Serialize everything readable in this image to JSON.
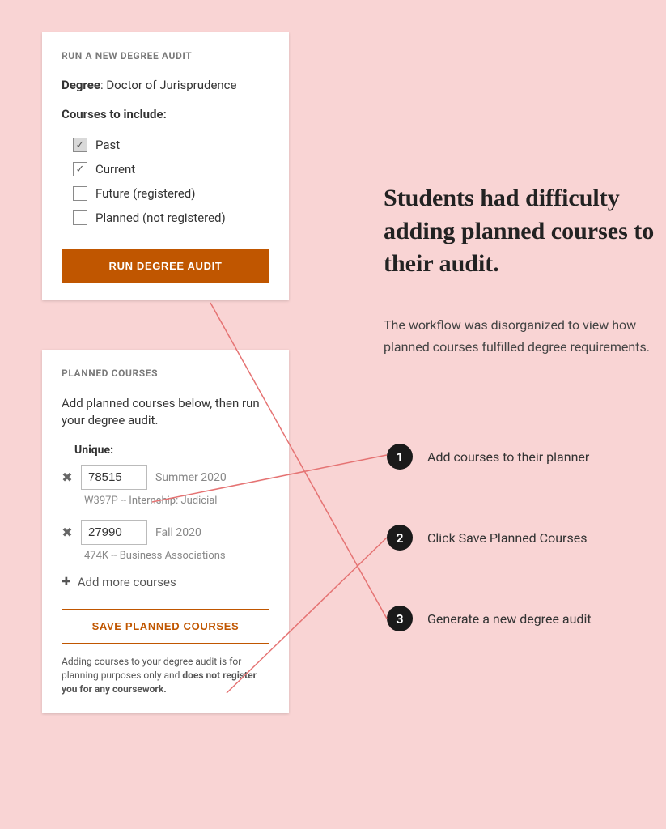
{
  "audit_panel": {
    "title": "RUN A NEW DEGREE AUDIT",
    "degree_label": "Degree",
    "degree_value": ": Doctor of Jurisprudence",
    "courses_label": "Courses to include",
    "courses_colon": ":",
    "options": [
      {
        "label": "Past",
        "checked": true,
        "disabled": true
      },
      {
        "label": "Current",
        "checked": true,
        "disabled": false
      },
      {
        "label": "Future (registered)",
        "checked": false,
        "disabled": false
      },
      {
        "label": "Planned (not registered)",
        "checked": false,
        "disabled": false
      }
    ],
    "run_button": "RUN DEGREE AUDIT"
  },
  "planned_panel": {
    "title": "PLANNED COURSES",
    "description": "Add planned courses below, then run your degree audit.",
    "unique_label": "Unique:",
    "courses": [
      {
        "unique": "78515",
        "term": "Summer 2020",
        "detail": "W397P -- Internship: Judicial"
      },
      {
        "unique": "27990",
        "term": "Fall 2020",
        "detail": "474K -- Business Associations"
      }
    ],
    "add_more": "Add more courses",
    "save_button": "SAVE PLANNED COURSES",
    "disclaimer_part1": "Adding courses to your degree audit is for planning purposes only and ",
    "disclaimer_bold": "does not register you for any coursework."
  },
  "headline": "Students had difficulty adding planned courses to their audit.",
  "subtext": "The workflow was disorganized to view how planned courses fulfilled degree requirements.",
  "steps": [
    {
      "num": "1",
      "text": "Add courses to their planner"
    },
    {
      "num": "2",
      "text": "Click Save Planned Courses"
    },
    {
      "num": "3",
      "text": "Generate a new degree audit"
    }
  ]
}
